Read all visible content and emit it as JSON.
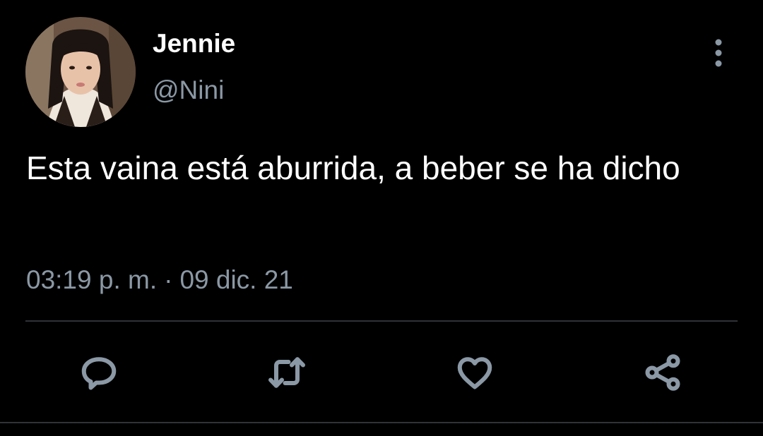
{
  "tweet": {
    "display_name": "Jennie",
    "handle": "@Nini",
    "text": "Esta vaina está aburrida, a beber se ha dicho",
    "time": "03:19 p. m.",
    "separator": "·",
    "date": "09 dic. 21"
  },
  "actions": {
    "icons": [
      "reply-icon",
      "retweet-icon",
      "like-icon",
      "share-icon"
    ]
  },
  "colors": {
    "background": "#000000",
    "primary_text": "#ffffff",
    "secondary_text": "#8b98a5",
    "divider": "#2f3336"
  }
}
